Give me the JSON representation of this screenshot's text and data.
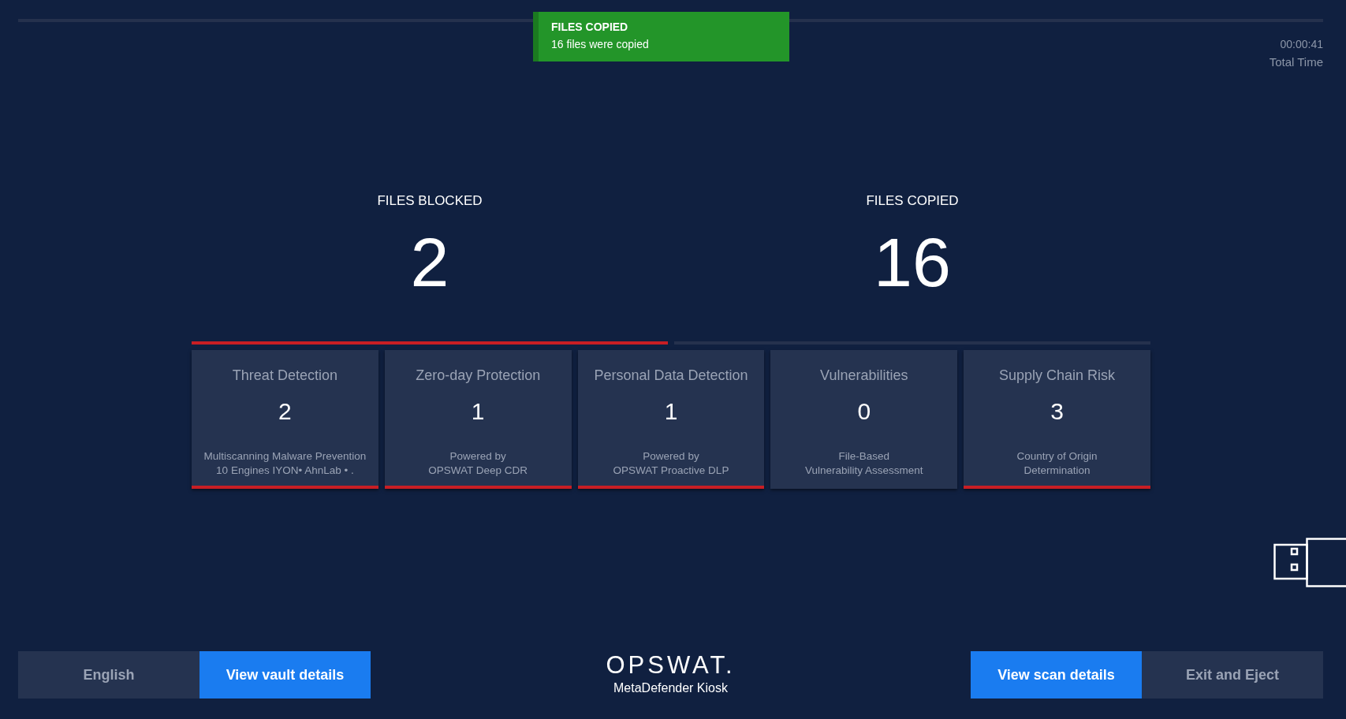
{
  "toast": {
    "title": "FILES COPIED",
    "message": "16 files were copied"
  },
  "timer": {
    "time": "00:00:41",
    "label": "Total Time"
  },
  "stats": [
    {
      "label": "FILES BLOCKED",
      "value": "2",
      "alert": true
    },
    {
      "label": "FILES COPIED",
      "value": "16",
      "alert": false
    }
  ],
  "cards": [
    {
      "title": "Threat Detection",
      "value": "2",
      "lines": [
        "Multiscanning Malware Prevention",
        "10 Engines  IYON• AhnLab • ."
      ],
      "alert": true
    },
    {
      "title": "Zero-day Protection",
      "value": "1",
      "lines": [
        "Powered by",
        "OPSWAT Deep CDR"
      ],
      "alert": true
    },
    {
      "title": "Personal Data Detection",
      "value": "1",
      "lines": [
        "Powered by",
        "OPSWAT Proactive DLP"
      ],
      "alert": true
    },
    {
      "title": "Vulnerabilities",
      "value": "0",
      "lines": [
        "File-Based",
        "Vulnerability Assessment"
      ],
      "alert": false
    },
    {
      "title": "Supply Chain Risk",
      "value": "3",
      "lines": [
        "Country of Origin",
        "Determination"
      ],
      "alert": true
    }
  ],
  "footer": {
    "left_buttons": [
      {
        "label": "English",
        "kind": "secondary"
      },
      {
        "label": "View vault details",
        "kind": "primary"
      }
    ],
    "logo": "OPSWAT.",
    "product": "MetaDefender Kiosk",
    "right_buttons": [
      {
        "label": "View scan details",
        "kind": "primary"
      },
      {
        "label": "Exit and Eject",
        "kind": "secondary"
      }
    ]
  }
}
